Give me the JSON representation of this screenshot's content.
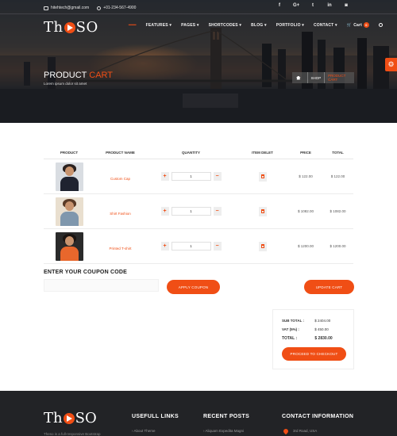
{
  "topbar": {
    "email": "hitehtech@gmail.com",
    "phone": "+01-234-567-4900",
    "social": [
      "f",
      "G+",
      "t",
      "in",
      "◙"
    ]
  },
  "brand": {
    "logo_left": "Th",
    "logo_right": "SO"
  },
  "nav": {
    "items": [
      "FEATURES ▾",
      "PAGES ▾",
      "SHORTCODES ▾",
      "BLOG ▾",
      "PORTFOLIO ▾",
      "CONTACT ▾"
    ],
    "cart_label": "Cart",
    "cart_count": "0"
  },
  "hero": {
    "title_main": "PRODUCT",
    "title_accent": "CART",
    "subtitle": "Lorem ipsum dolor sit amet",
    "breadcrumb_home": "SHOP",
    "breadcrumb_current": "PRODUCT CART"
  },
  "cart": {
    "headers": {
      "product": "PRODUCT",
      "name": "PRODUCT NAME",
      "quantity": "QUANTITY",
      "delete": "ITEM DELET",
      "price": "PRICE",
      "total": "TOTAL"
    },
    "rows": [
      {
        "name": "Custom Cap",
        "qty": "1",
        "price": "$ 122.00",
        "total": "$ 122.00"
      },
      {
        "name": "Shirt Fashion",
        "qty": "1",
        "price": "$ 1082.00",
        "total": "$ 1082.00"
      },
      {
        "name": "Printed T-shirt",
        "qty": "1",
        "price": "$ 1200.00",
        "total": "$ 1200.00"
      }
    ]
  },
  "coupon": {
    "title": "ENTER YOUR COUPON CODE",
    "placeholder": "",
    "apply_label": "APPLY COUPON",
    "update_label": "UPDATE CART"
  },
  "totals": {
    "subtotal_label": "SUB TOTAL :",
    "subtotal_value": "$ 2404.00",
    "vat_label": "VAT (5%) :",
    "vat_value": "$ 450.00",
    "total_label": "TOTAL :",
    "total_value": "$ 2830.00",
    "checkout_label": "PROCEED TO CHECKOUT"
  },
  "footer": {
    "tagline": "Theso is a full-responsive Bootstrap",
    "useful_links": "USEFULL LINKS",
    "useful_item": "About Theme",
    "recent_posts": "RECENT POSTS",
    "recent_item": "Aliquam Expedita Magni",
    "contact": "CONTACT INFORMATION",
    "contact_item": "3rd Road, USA"
  },
  "colors": {
    "accent": "#f04e15",
    "footer_bg": "#222326"
  }
}
